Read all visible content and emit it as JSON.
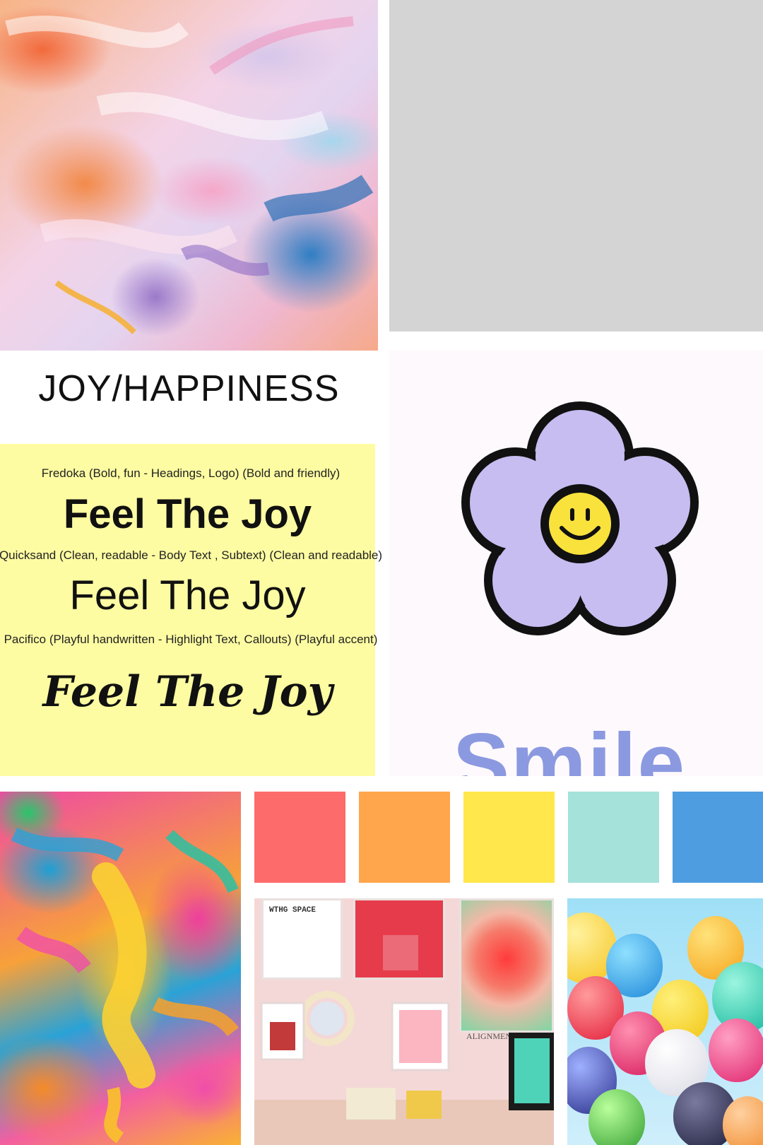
{
  "title": "JOY/HAPPINESS",
  "typography": {
    "font1_note": "Fredoka (Bold, fun - Headings, Logo) (Bold and friendly)",
    "font1_sample": "Feel The Joy",
    "font2_note": "Quicksand (Clean, readable - Body Text , Subtext) (Clean and readable)",
    "font2_sample": "Feel The Joy",
    "font3_note": "Pacifico (Playful handwritten - Highlight Text, Callouts) (Playful accent)",
    "font3_sample": "Feel The Joy"
  },
  "flower_panel": {
    "word": "Smile"
  },
  "palette": [
    "#fe6b6b",
    "#ffa64d",
    "#ffe74c",
    "#a5e2da",
    "#4d9de0"
  ],
  "room_photo": {
    "poster_text_top": "WTHG SPACE",
    "poster_text_side": "ALIGNMEN"
  }
}
